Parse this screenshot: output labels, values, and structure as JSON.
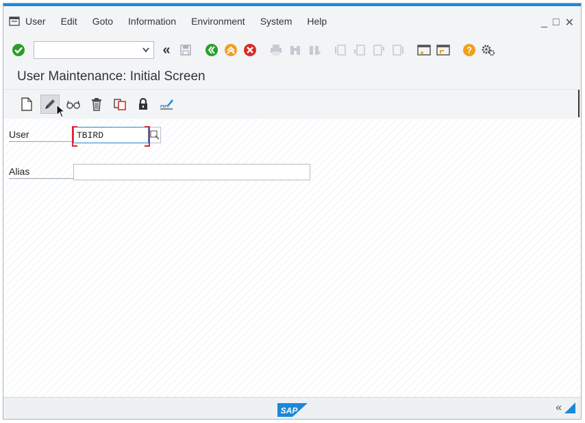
{
  "menu": {
    "items": [
      "User",
      "Edit",
      "Goto",
      "Information",
      "Environment",
      "System",
      "Help"
    ]
  },
  "window_controls": {
    "minimize": "_",
    "maximize": "□",
    "close": "✕"
  },
  "toolbar": {
    "command_field_value": "",
    "back_glyph": "«"
  },
  "page": {
    "title": "User Maintenance: Initial Screen"
  },
  "form": {
    "user_label": "User",
    "user_value": "TBIRD",
    "alias_label": "Alias",
    "alias_value": ""
  },
  "footer": {
    "logo_text": "SAP",
    "collapse_glyph": "«"
  },
  "colors": {
    "accent": "#1a8ad8",
    "ok_green": "#2a9d2a",
    "exit_orange": "#f0a020",
    "cancel_red": "#d92b2b",
    "help_orange": "#f0a020"
  },
  "icons": {
    "menu": "menu-icon",
    "ok": "check-icon",
    "back": "back-icon",
    "save": "save-icon",
    "exit": "exit-icon",
    "cancel": "cancel-icon",
    "print": "print-icon",
    "find": "binoculars-icon",
    "create": "new-document-icon",
    "change": "pencil-icon",
    "display": "glasses-icon",
    "delete": "trash-icon",
    "copy": "copy-icon",
    "lock": "lock-icon",
    "password": "signature-icon",
    "help": "help-icon",
    "settings": "gear-icon"
  }
}
